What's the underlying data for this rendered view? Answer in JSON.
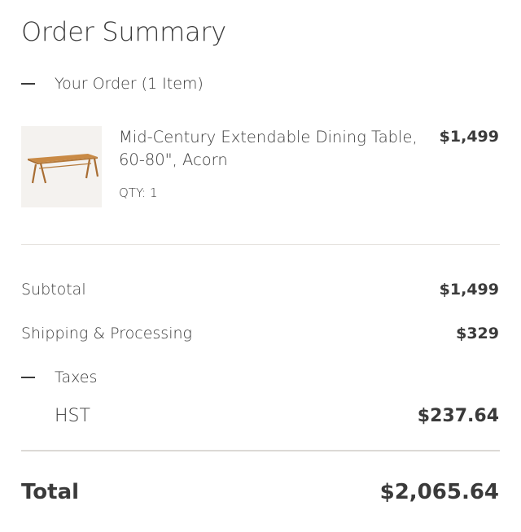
{
  "summary": {
    "title": "Order Summary",
    "order_toggle_label": "Your Order (1 Item)"
  },
  "item": {
    "name": "Mid-Century Extendable Dining Table, 60-80\", Acorn",
    "qty": "QTY: 1",
    "price": "$1,499",
    "image_icon": "dining-table-image"
  },
  "totals": {
    "subtotal_label": "Subtotal",
    "subtotal_value": "$1,499",
    "shipping_label": "Shipping & Processing",
    "shipping_value": "$329",
    "taxes_label": "Taxes",
    "hst_label": "HST",
    "hst_value": "$237.64",
    "total_label": "Total",
    "total_value": "$2,065.64"
  },
  "colors": {
    "text": "#3a3a3a",
    "divider": "#e6e3df",
    "image_bg": "#f4f2ef",
    "wood": "#c98a45"
  }
}
